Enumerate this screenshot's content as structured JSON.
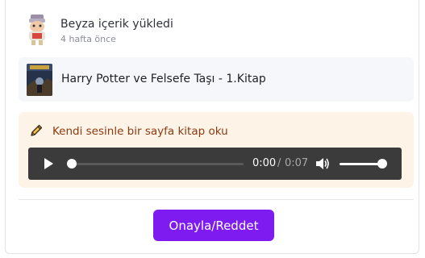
{
  "activity": {
    "user_line": "Beyza içerik yükledi",
    "time_ago": "4 hafta önce",
    "avatar_icon": "character-avatar-icon"
  },
  "book": {
    "title": "Harry Potter ve Felsefe Taşı - 1.Kitap",
    "cover_icon": "book-cover-image"
  },
  "task": {
    "icon": "pencil-icon",
    "text": "Kendi sesinle bir sayfa kitap oku",
    "background": "#fdf3e7",
    "text_color": "#8a3a10"
  },
  "audio_player": {
    "current_time": "0:00",
    "separator": "/",
    "duration": "0:07",
    "progress_fraction": 0,
    "volume_fraction": 1
  },
  "actions": {
    "approve_label": "Onayla/Reddet",
    "accent": "#7d1bf0"
  }
}
